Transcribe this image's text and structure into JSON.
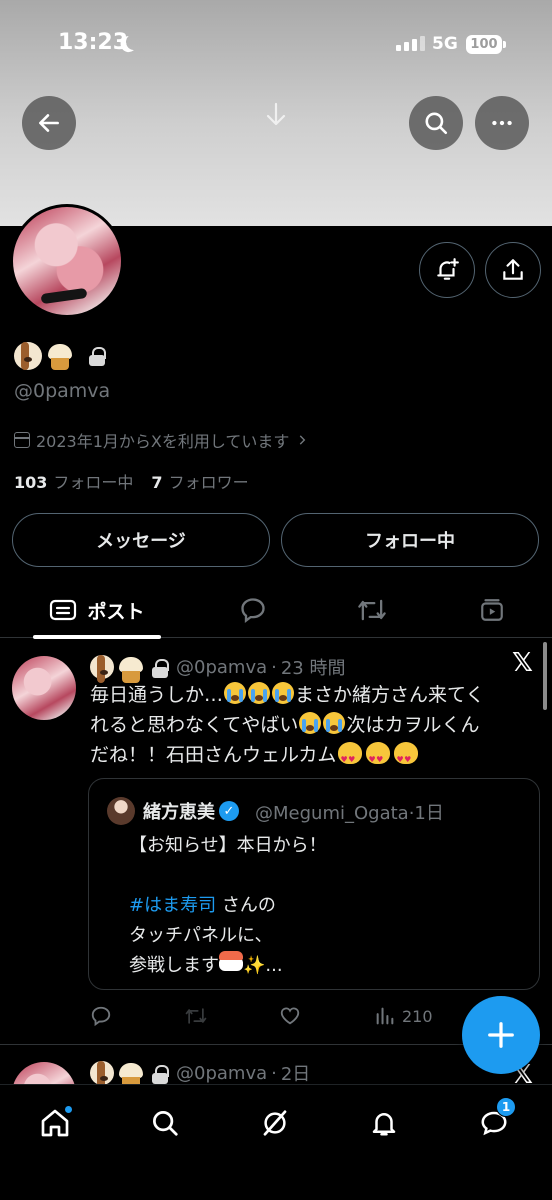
{
  "status_bar": {
    "time": "13:23",
    "network": "5G",
    "battery": "100"
  },
  "profile": {
    "handle": "@0pamva",
    "joined": "2023年1月からXを利用しています",
    "following_count": "103",
    "following_label": "フォロー中",
    "followers_count": "7",
    "followers_label": "フォロワー"
  },
  "buttons": {
    "message": "メッセージ",
    "following": "フォロー中"
  },
  "tabs": [
    {
      "label": "ポスト",
      "icon": "posts-icon",
      "active": true
    },
    {
      "label": "",
      "icon": "replies-icon"
    },
    {
      "label": "",
      "icon": "repost-icon"
    },
    {
      "label": "",
      "icon": "media-icon"
    }
  ],
  "tweets": [
    {
      "handle": "@0pamva",
      "time": "23 時間",
      "text_1": "毎日通うしか…",
      "text_2": "まさか緒方さん来てく",
      "text_3": "れると思わなくてやばい",
      "text_4": "次はカヲルくん",
      "text_5": "だね！！石田さんウェルカム",
      "quote": {
        "name": "緒方恵美",
        "handle": "@Megumi_Ogata",
        "time": "1日",
        "line_1": "【お知らせ】本日から！",
        "hashtag": "#はま寿司",
        "line_2": " さんの",
        "line_3": "タッチパネルに、",
        "line_4": "参戦します",
        "ellipsis": "..."
      },
      "views": "210"
    },
    {
      "handle": "@0pamva",
      "time": "2日"
    }
  ],
  "notifications_badge": "1",
  "colors": {
    "accent": "#1d9bf0",
    "background": "#000000",
    "secondary_text": "#71767b"
  }
}
